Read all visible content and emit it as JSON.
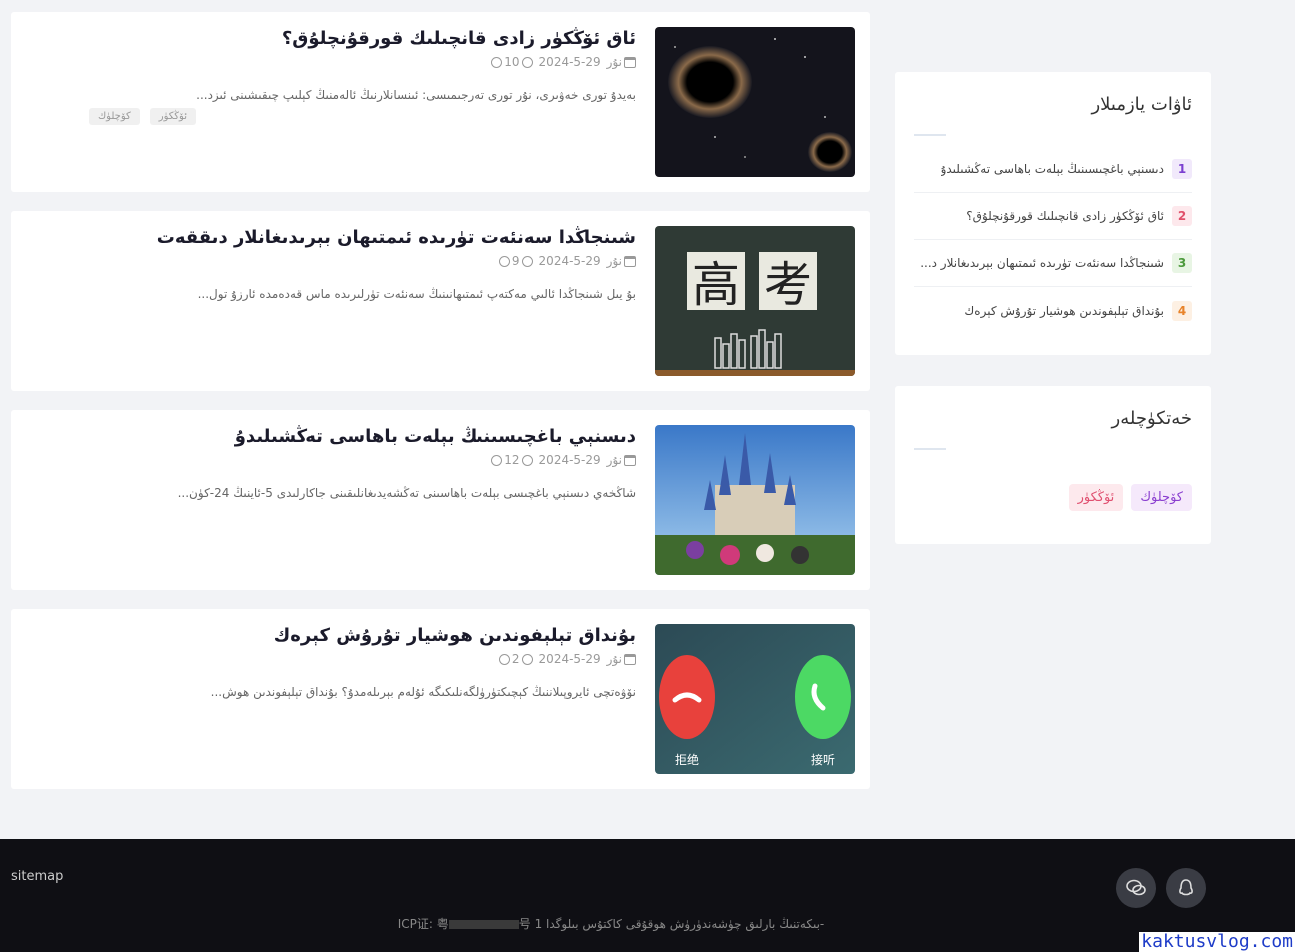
{
  "posts": [
    {
      "title": "ئاق ئۆڭكۈر زادى قانچىلىك قورقۇنچلۇق؟",
      "author": "نۇر",
      "date": "2024-5-29",
      "views": "10",
      "excerpt": "بەيدۇ تورى خەۋىرى، نۇر تورى تەرجىمىسى: ئىنسانلارنىڭ ئالەمنىڭ كېلىپ چىقىشىنى ئىزد...",
      "tags": [
        "ئۆڭكۈر",
        "كۆچلۈك"
      ],
      "thumb_icon": "black-hole-image"
    },
    {
      "title": "شىنجاڭدا سەنئەت تۈرىدە ئىمتىھان بېرىدىغانلار دىققەت",
      "author": "نۇر",
      "date": "2024-5-29",
      "views": "9",
      "excerpt": "بۇ يىل شىنجاڭدا ئالىي مەكتەپ ئىمتىھانىنىڭ سەنئەت تۈرلىرىدە ماس قەدەمدە ئارزۇ تول...",
      "tags": [],
      "thumb_icon": "gaokao-chalkboard-image",
      "thumb_chars": [
        "高",
        "考"
      ]
    },
    {
      "title": "دىسنېي باغچىسىنىڭ بېلەت باھاسى تەڭشىلىدۇ",
      "author": "نۇر",
      "date": "2024-5-29",
      "views": "12",
      "excerpt": "شاڭخەي دىسنېي باغچىسى بېلەت باھاسىنى تەڭشەيدىغانلىقىنى جاكارلىدى 5-ئاينىڭ 24-كۈن...",
      "tags": [],
      "thumb_icon": "disney-castle-image"
    },
    {
      "title": "بۇنداق تېلېفوندىن ھوشيار تۇرۇش كېرەك",
      "author": "نۇر",
      "date": "2024-5-29",
      "views": "2",
      "excerpt": "نۆۋەتچى ئايروپىلاننىڭ كېچىكتۈرۈلگەنلىكىگە ئۇلەم بېرىلەمدۇ؟ بۇنداق تېلېفوندىن ھوش...",
      "tags": [],
      "thumb_icon": "phone-call-image",
      "thumb_labels": [
        "拒绝",
        "接听"
      ]
    }
  ],
  "hot": {
    "title": "ئاۋات يازمىلار",
    "items": [
      {
        "num": "1",
        "text": "دىسنېي باغچىسىنىڭ بېلەت باھاسى تەڭشىلىدۇ",
        "color": "#7b3fd0",
        "bg": "#f1e9fb"
      },
      {
        "num": "2",
        "text": "ئاق ئۆڭكۈر زادى قانچىلىك قورقۇنچلۇق؟",
        "color": "#e0506a",
        "bg": "#fde8ec"
      },
      {
        "num": "3",
        "text": "شىنجاڭدا سەنئەت تۈرىدە ئىمتىھان بېرىدىغانلار د...",
        "color": "#4c9a3c",
        "bg": "#e8f5e4"
      },
      {
        "num": "4",
        "text": "بۇنداق تېلېفوندىن ھوشيار تۇرۇش كېرەك",
        "color": "#e8832a",
        "bg": "#fdf0e3"
      }
    ]
  },
  "tag_cloud": {
    "title": "خەتكۈچلەر",
    "tags": [
      {
        "label": "كۆچلۈك",
        "color": "#8b3fd0",
        "bg": "#f5e9fb"
      },
      {
        "label": "ئۆڭكۈر",
        "color": "#e05070",
        "bg": "#fde9ed"
      }
    ]
  },
  "footer": {
    "sitemap": "sitemap",
    "copyright_text": "بىكەتنىڭ بارلىق چۈشەندۈرۈش ھوقۇقى كاكتۇس بىلوگدا 1-",
    "icp_suffix": "号",
    "icp_prefix": "ICP证: 粤",
    "social": [
      "wechat-icon",
      "qq-icon"
    ]
  },
  "watermark": "kaktusvlog.com"
}
